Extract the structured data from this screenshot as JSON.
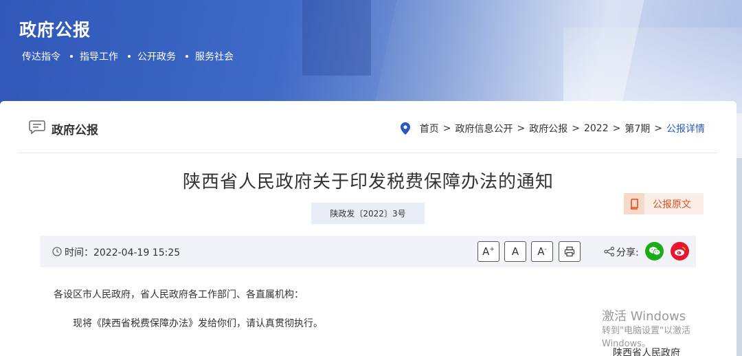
{
  "header": {
    "site_title": "政府公报",
    "tags": [
      "传达指令",
      "指导工作",
      "公开政务",
      "服务社会"
    ]
  },
  "section": {
    "title": "政府公报",
    "icon": "chat-icon"
  },
  "breadcrumb": {
    "icon": "location-pin-icon",
    "items": [
      "首页",
      "政府信息公开",
      "政府公报",
      "2022",
      "第7期"
    ],
    "current": "公报详情",
    "separator": ">"
  },
  "document": {
    "title": "陕西省人民政府关于印发税费保障办法的通知",
    "number": "陕政发〔2022〕3号",
    "original_button": "公报原文",
    "time_label": "时间：2022-04-19 15:25",
    "font_controls": [
      "A",
      "A",
      "A"
    ],
    "font_control_marks": [
      "+",
      "",
      "-"
    ],
    "share_label": "分享:",
    "salutation": "各设区市人民政府，省人民政府各工作部门、各直属机构：",
    "body": "现将《陕西省税费保障办法》发给你们，请认真贯彻执行。",
    "signature": "陕西省人民政府"
  },
  "watermark": {
    "line1": "激活 Windows",
    "line2": "转到\"电脑设置\"以激活 Windows。"
  },
  "colors": {
    "accent": "#2a58c0",
    "orange": "#d9531e",
    "wechat": "#1aad19",
    "weibo": "#e6162d"
  }
}
